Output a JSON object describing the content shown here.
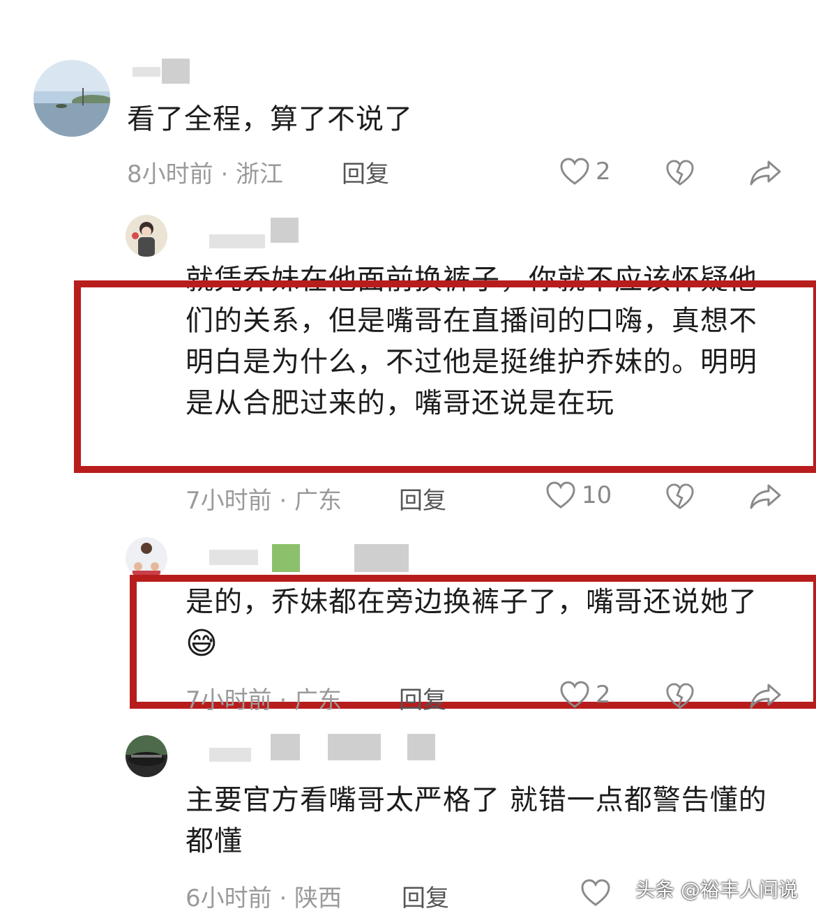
{
  "comments": [
    {
      "text": "看了全程，算了不说了",
      "meta": "8小时前 · 浙江",
      "reply": "回复",
      "likes": "2"
    },
    {
      "text": "就凭乔妹在他面前换裤子，你就不应该怀疑他们的关系，但是嘴哥在直播间的口嗨，真想不明白是为什么，不过他是挺维护乔妹的。明明是从合肥过来的，嘴哥还说是在玩",
      "meta": "7小时前 · 广东",
      "reply": "回复",
      "likes": "10"
    },
    {
      "text": "是的，乔妹都在旁边换裤子了，嘴哥还说她了",
      "emoji": "😅",
      "meta": "7小时前 · 广东",
      "reply": "回复",
      "likes": "2"
    },
    {
      "text": "主要官方看嘴哥太严格了  就错一点都警告懂的都懂",
      "meta": "6小时前 · 陕西",
      "reply": "回复",
      "likes": ""
    }
  ],
  "watermark": "头条 @裕丰人间说",
  "colors": {
    "highlight_box": "#b81d1d",
    "meta_text": "#9a9a9a"
  },
  "icons": [
    "heart-icon",
    "dislike-heart-icon",
    "share-icon"
  ]
}
